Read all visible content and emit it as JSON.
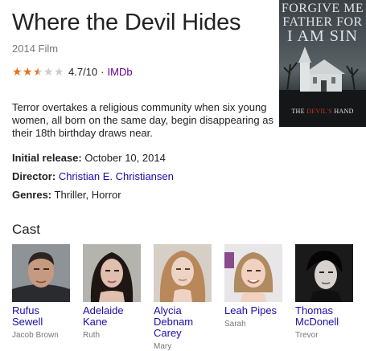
{
  "header": {
    "title": "Where the Devil Hides",
    "subtitle": "2014 Film"
  },
  "rating": {
    "value": "4.7/10",
    "separator": "·",
    "source": "IMDb",
    "stars_filled": 2.5,
    "stars_total": 5,
    "star_color": "#e7711b"
  },
  "poster": {
    "line1": "FORGIVE ME",
    "line2": "FATHER FOR",
    "line3": "I AM SIN",
    "tagline_prefix": "THE",
    "tagline_highlight": "DEVIL'S",
    "tagline_suffix": "HAND"
  },
  "description": "Terror overtakes a religious community when six young women, all born on the same day, begin disappearing as their 18th birthday draws near.",
  "facts": {
    "release_label": "Initial release:",
    "release_value": "October 10, 2014",
    "director_label": "Director:",
    "director_value": "Christian E. Christiansen",
    "genres_label": "Genres:",
    "genres_value": "Thriller, Horror"
  },
  "cast": {
    "heading": "Cast",
    "members": [
      {
        "name": "Rufus Sewell",
        "role": "Jacob Brown"
      },
      {
        "name": "Adelaide Kane",
        "role": "Ruth"
      },
      {
        "name": "Alycia Debnam Carey",
        "role": "Mary"
      },
      {
        "name": "Leah Pipes",
        "role": "Sarah"
      },
      {
        "name": "Thomas McDonell",
        "role": "Trevor"
      }
    ]
  },
  "colors": {
    "link": "#1a0dab",
    "visited_link": "#660099",
    "muted_text": "#777777"
  }
}
